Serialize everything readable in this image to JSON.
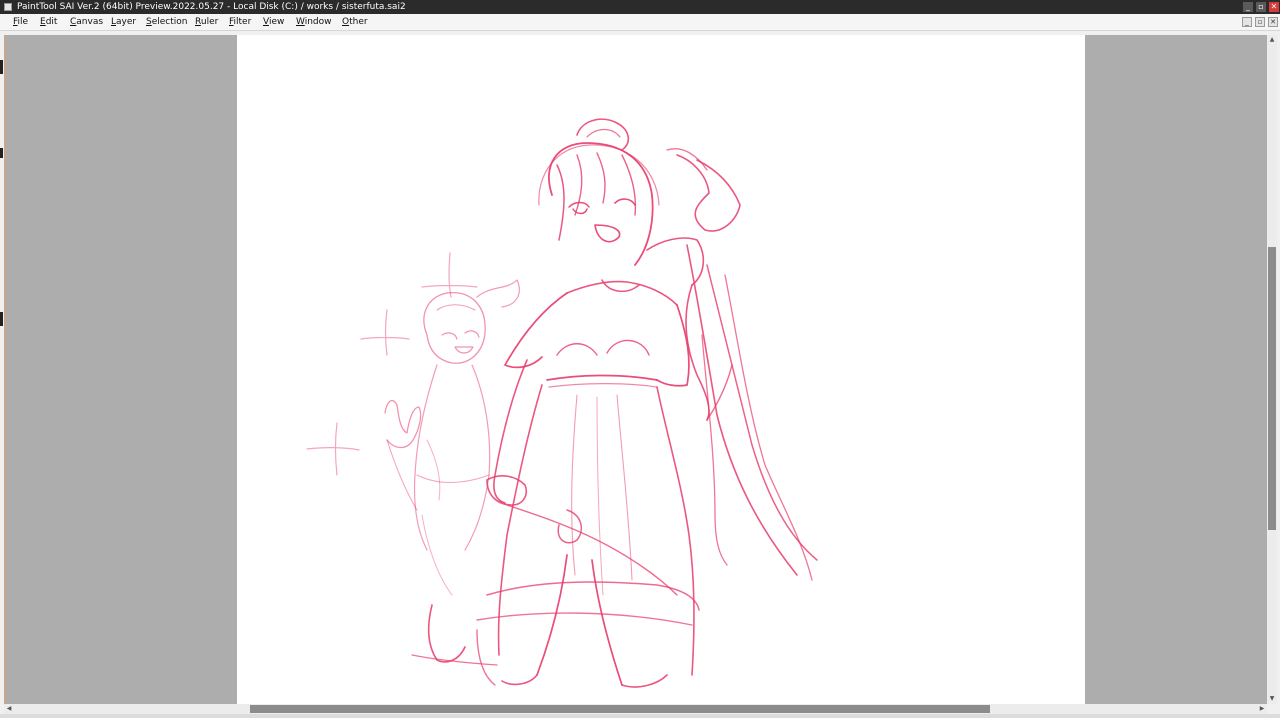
{
  "window": {
    "title": "PaintTool SAI Ver.2 (64bit) Preview.2022.05.27 - Local Disk (C:) / works / sisterfuta.sai2",
    "minimize_glyph": "_",
    "restore_glyph": "▫",
    "close_glyph": "✕"
  },
  "menu": {
    "items": [
      {
        "mnemonic": "F",
        "rest": "ile"
      },
      {
        "mnemonic": "E",
        "rest": "dit"
      },
      {
        "mnemonic": "C",
        "rest": "anvas"
      },
      {
        "mnemonic": "L",
        "rest": "ayer"
      },
      {
        "mnemonic": "S",
        "rest": "election"
      },
      {
        "mnemonic": "R",
        "rest": "uler"
      },
      {
        "mnemonic": "F",
        "rest": "ilter"
      },
      {
        "mnemonic": "V",
        "rest": "iew"
      },
      {
        "mnemonic": "W",
        "rest": "indow"
      },
      {
        "mnemonic": "O",
        "rest": "ther"
      }
    ]
  },
  "canvas": {
    "stroke_color": "#e83a6a",
    "background_color": "#adadad",
    "paper_color": "#ffffff",
    "icons": {
      "sketch": "pink-line-sketch-of-two-anime-girls"
    }
  },
  "scrollbars": {
    "up_glyph": "▲",
    "down_glyph": "▼",
    "left_glyph": "◀",
    "right_glyph": "▶"
  },
  "colors": {
    "titlebar": "#2b2b2b",
    "close_button": "#d63a3a",
    "scroll_thumb": "#8c8c8c"
  }
}
